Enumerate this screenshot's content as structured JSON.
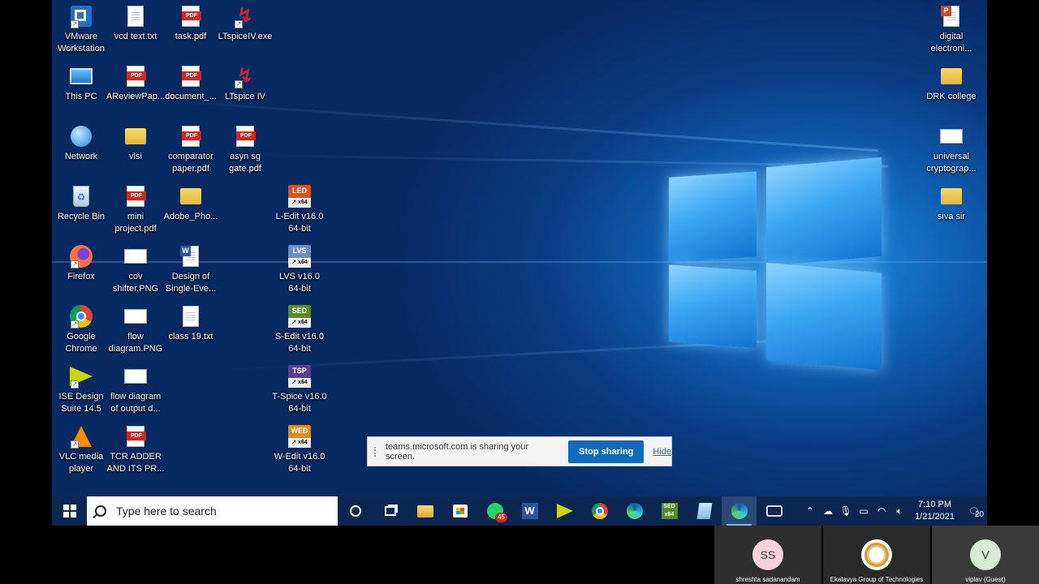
{
  "desktop": {
    "icons": [
      {
        "label": "VMware\nWorkstation",
        "icon": "vmware-icon"
      },
      {
        "label": "vcd text.txt",
        "icon": "text-file-icon"
      },
      {
        "label": "task.pdf",
        "icon": "pdf-file-icon"
      },
      {
        "label": "LTspiceIV.exe",
        "icon": "ltspice-icon"
      },
      {
        "label": "This PC",
        "icon": "computer-icon"
      },
      {
        "label": "AReviewPap...",
        "icon": "pdf-file-icon"
      },
      {
        "label": "document_...",
        "icon": "pdf-file-icon"
      },
      {
        "label": "LTspice IV",
        "icon": "ltspice-icon"
      },
      {
        "label": "Network",
        "icon": "network-icon"
      },
      {
        "label": "vlsi",
        "icon": "folder-icon"
      },
      {
        "label": "comparator\npaper.pdf",
        "icon": "pdf-file-icon"
      },
      {
        "label": "asyn sg\ngate.pdf",
        "icon": "pdf-file-icon"
      },
      {
        "label": "Recycle Bin",
        "icon": "recycle-bin-icon"
      },
      {
        "label": "mini\nproject.pdf",
        "icon": "pdf-file-icon"
      },
      {
        "label": "Adobe_Pho...",
        "icon": "folder-icon"
      },
      {
        "label": "L-Edit v16.0\n64-bit",
        "icon": "tanner-ledit-icon",
        "badge": "LED",
        "color": "#d9531e"
      },
      {
        "label": "Firefox",
        "icon": "firefox-icon"
      },
      {
        "label": "cov\nshifter.PNG",
        "icon": "image-file-icon"
      },
      {
        "label": "Design of\nSingle-Eve...",
        "icon": "word-doc-icon"
      },
      {
        "label": "LVS v16.0\n64-bit",
        "icon": "tanner-lvs-icon",
        "badge": "LVS",
        "color": "#6a8ec8"
      },
      {
        "label": "Google\nChrome",
        "icon": "chrome-icon"
      },
      {
        "label": "flow\ndiagram.PNG",
        "icon": "image-file-icon"
      },
      {
        "label": "class 19.txt",
        "icon": "text-file-icon"
      },
      {
        "label": "S-Edit v16.0\n64-bit",
        "icon": "tanner-sedit-icon",
        "badge": "SED",
        "color": "#5b8a2d"
      },
      {
        "label": "ISE Design\nSuite 14.5",
        "icon": "xilinx-ise-icon"
      },
      {
        "label": "flow diagram\nof output d...",
        "icon": "image-file-icon"
      },
      {
        "label": "T-Spice v16.0\n64-bit",
        "icon": "tanner-tspice-icon",
        "badge": "TSP",
        "color": "#5a3f8f"
      },
      {
        "label": "VLC media\nplayer",
        "icon": "vlc-icon"
      },
      {
        "label": "TCR ADDER\nAND ITS PR...",
        "icon": "pdf-file-icon"
      },
      {
        "label": "W-Edit v16.0\n64-bit",
        "icon": "tanner-wedit-icon",
        "badge": "WED",
        "color": "#e0891f"
      },
      {
        "label": "digital\nelectroni...",
        "icon": "powerpoint-file-icon"
      },
      {
        "label": "DRK college",
        "icon": "folder-icon"
      },
      {
        "label": "universal\ncryptograp...",
        "icon": "image-file-icon"
      },
      {
        "label": "siva sir",
        "icon": "folder-icon"
      }
    ]
  },
  "sharebar": {
    "message": "teams.microsoft.com is sharing your screen.",
    "stop_label": "Stop sharing",
    "hide_label": "Hide"
  },
  "taskbar": {
    "search_placeholder": "Type here to search",
    "apps": [
      {
        "name": "cortana-icon"
      },
      {
        "name": "task-view-icon"
      },
      {
        "name": "file-explorer-icon"
      },
      {
        "name": "store-icon"
      },
      {
        "name": "whatsapp-icon",
        "badge": "45"
      },
      {
        "name": "word-icon"
      },
      {
        "name": "xilinx-ise-icon"
      },
      {
        "name": "chrome-icon"
      },
      {
        "name": "edge-icon"
      },
      {
        "name": "tanner-sedit-icon"
      },
      {
        "name": "notepad-icon"
      },
      {
        "name": "teams-edge-icon",
        "active": true
      },
      {
        "name": "snipping-tool-icon"
      }
    ],
    "clock_time": "7:10 PM",
    "clock_date": "1/21/2021",
    "notification_count": "20"
  },
  "participants": [
    {
      "initials": "SS",
      "name": "shreshta sadanandam",
      "color": "#f6d3dc"
    },
    {
      "initials": "",
      "name": "Ekalavya Group of Technologies",
      "color": "#ffffff"
    },
    {
      "initials": "V",
      "name": "viplav (Guest)",
      "color": "#d6ecd2"
    }
  ]
}
